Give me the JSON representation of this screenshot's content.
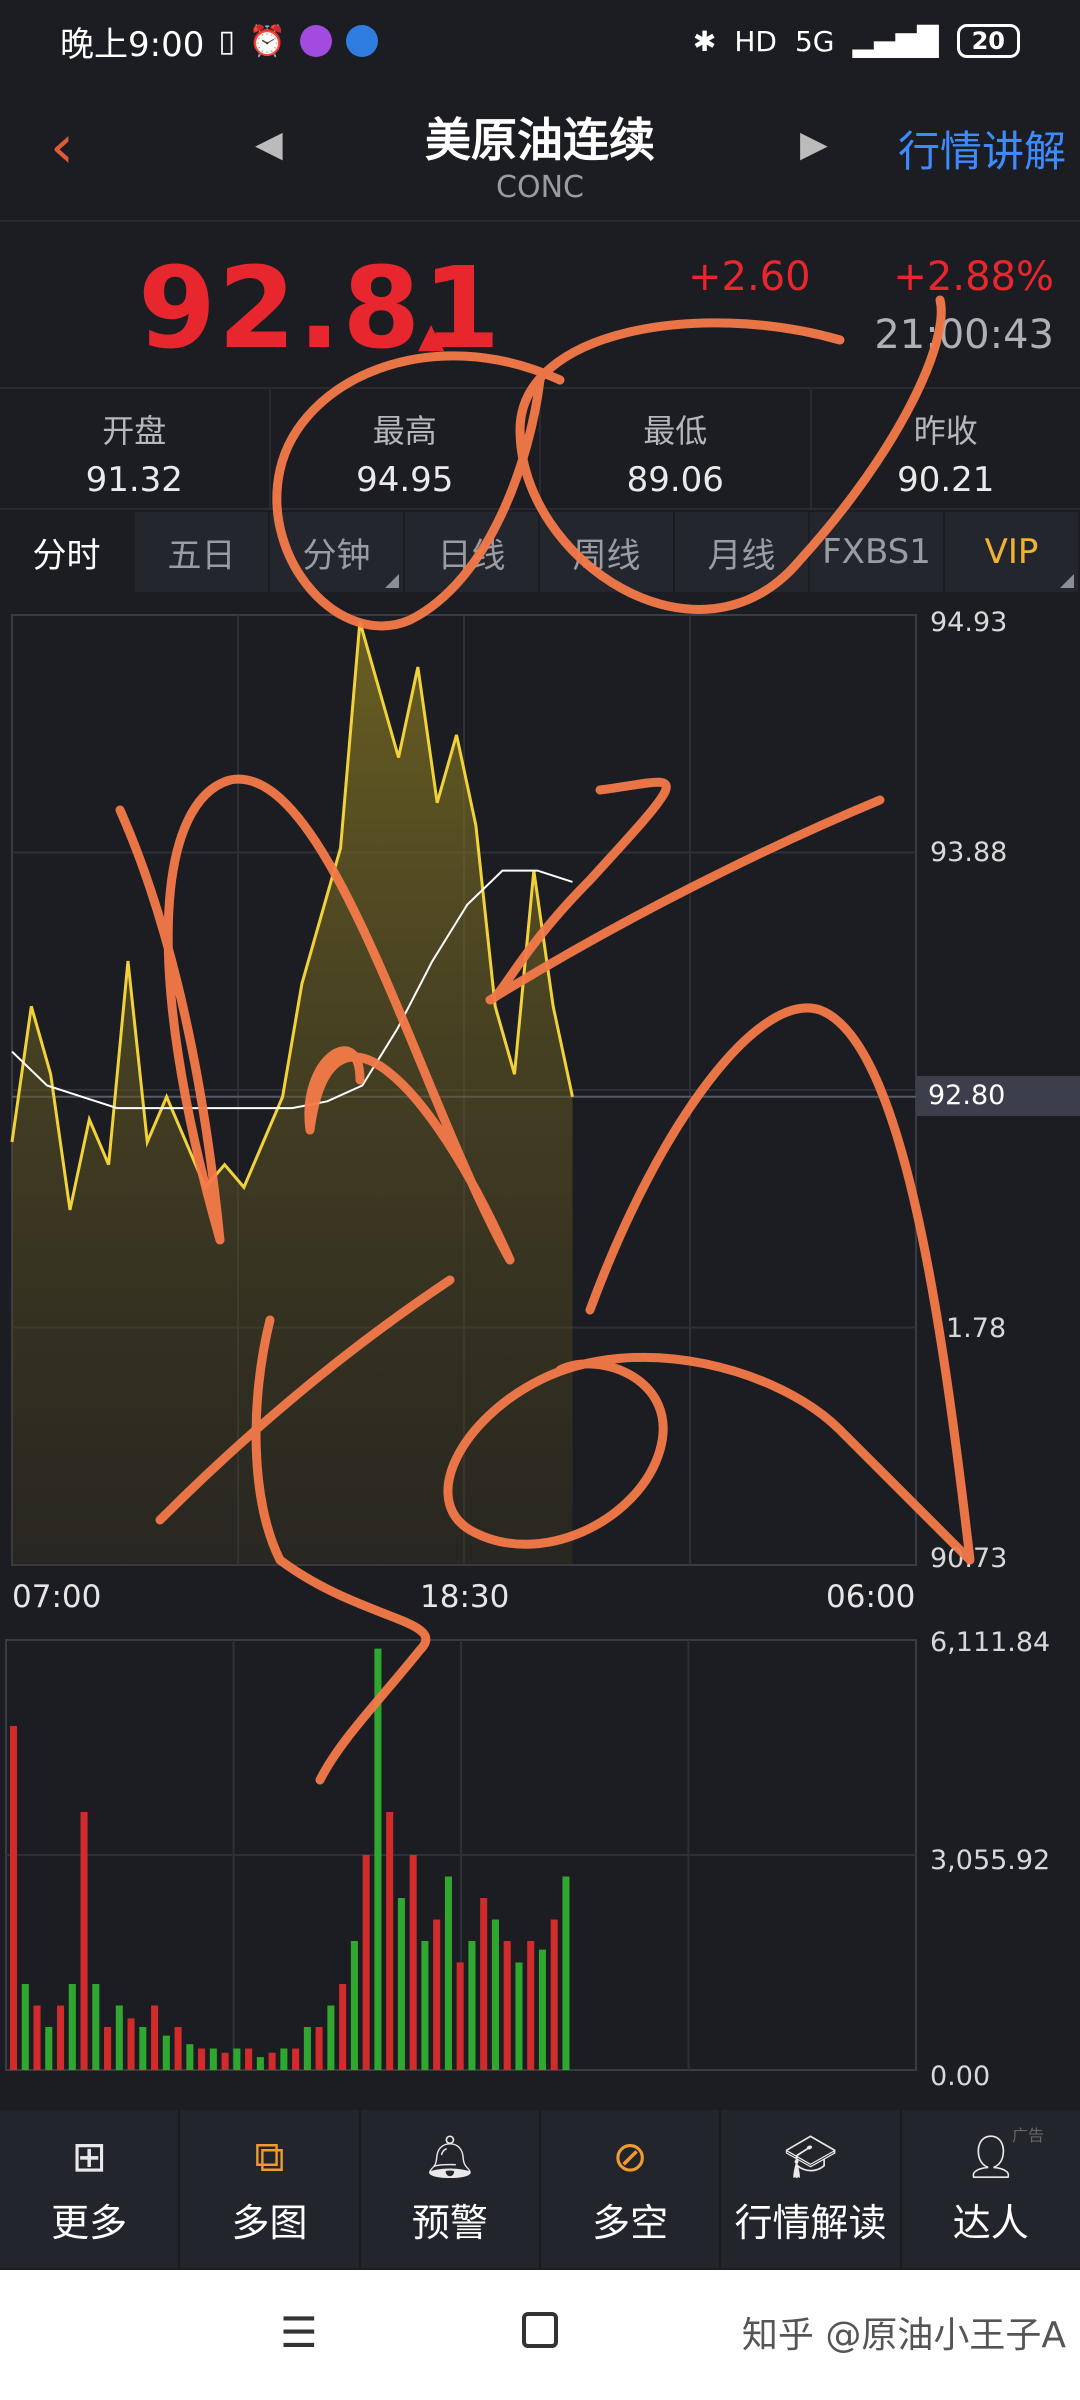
{
  "status": {
    "time": "晚上9:00",
    "network": "5G",
    "battery": "20"
  },
  "header": {
    "title": "美原油连续",
    "code": "CONC",
    "explain_label": "行情讲解"
  },
  "quote": {
    "price": "92.81",
    "change": "+2.60",
    "pct": "+2.88%",
    "clock": "21:00:43"
  },
  "stats": [
    {
      "label": "开盘",
      "value": "91.32"
    },
    {
      "label": "最高",
      "value": "94.95"
    },
    {
      "label": "最低",
      "value": "89.06"
    },
    {
      "label": "昨收",
      "value": "90.21"
    }
  ],
  "tabs": [
    "分时",
    "五日",
    "分钟",
    "日线",
    "周线",
    "月线",
    "FXBS1",
    "VIP"
  ],
  "chart_data": {
    "type": "line",
    "series": [
      {
        "values": [
          92.6,
          93.2,
          92.9,
          92.3,
          92.7,
          92.5,
          93.4,
          92.6,
          92.8,
          92.6,
          92.4,
          92.5,
          92.4,
          92.6,
          92.8,
          93.3,
          93.6,
          93.9,
          94.9,
          94.6,
          94.3,
          94.7,
          94.1,
          94.4,
          94.0,
          93.2,
          92.9,
          93.8,
          93.2,
          92.8
        ]
      },
      {
        "values": [
          93.0,
          92.85,
          92.8,
          92.75,
          92.75,
          92.75,
          92.75,
          92.75,
          92.75,
          92.78,
          92.85,
          93.1,
          93.4,
          93.65,
          93.8,
          93.8,
          93.75
        ]
      }
    ],
    "x_ticks": [
      "07:00",
      "18:30",
      "06:00"
    ],
    "y_ticks": [
      "94.93",
      "93.88",
      "92.80",
      "1.78",
      "90.73"
    ],
    "current": "92.80",
    "volume": {
      "y_ticks": [
        "6,111.84",
        "3,055.92",
        "0.00"
      ],
      "values": [
        0.8,
        0.2,
        0.15,
        0.1,
        0.15,
        0.2,
        0.6,
        0.2,
        0.1,
        0.15,
        0.12,
        0.1,
        0.15,
        0.08,
        0.1,
        0.06,
        0.05,
        0.05,
        0.04,
        0.05,
        0.05,
        0.03,
        0.04,
        0.05,
        0.05,
        0.1,
        0.1,
        0.15,
        0.2,
        0.3,
        0.5,
        0.98,
        0.6,
        0.4,
        0.5,
        0.3,
        0.35,
        0.45,
        0.25,
        0.3,
        0.4,
        0.35,
        0.3,
        0.25,
        0.3,
        0.28,
        0.35,
        0.45
      ],
      "colors": [
        "#d22b2b",
        "#2fa82f"
      ]
    }
  },
  "toolbar": [
    {
      "label": "更多",
      "icon": "grid-icon"
    },
    {
      "label": "多图",
      "icon": "multi-chart-icon"
    },
    {
      "label": "预警",
      "icon": "bell-icon"
    },
    {
      "label": "多空",
      "icon": "trend-icon"
    },
    {
      "label": "行情解读",
      "icon": "graduation-cap-icon"
    },
    {
      "label": "达人",
      "icon": "user-icon"
    }
  ],
  "ad_label": "广告",
  "watermark": "知乎 @原油小王子A"
}
